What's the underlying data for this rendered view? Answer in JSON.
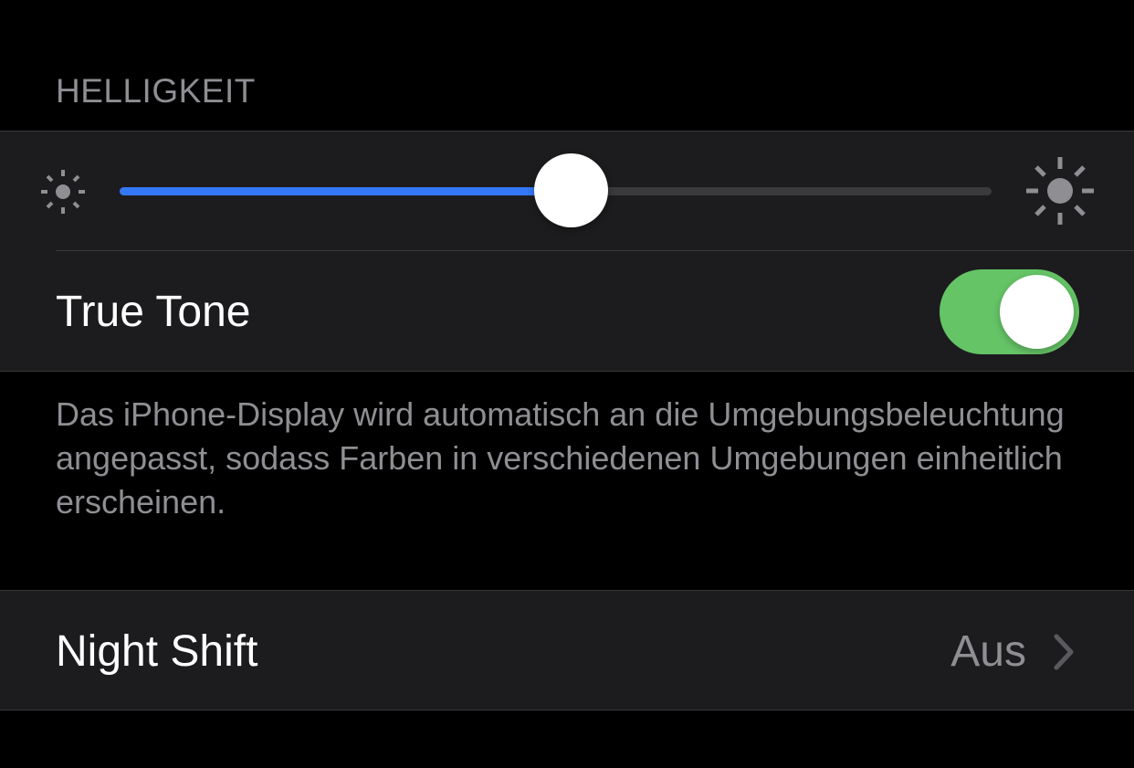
{
  "brightness": {
    "section_header": "HELLIGKEIT",
    "level": 0.52,
    "min_icon": "sun-min-icon",
    "max_icon": "sun-max-icon"
  },
  "true_tone": {
    "label": "True Tone",
    "enabled": true,
    "footnote": "Das iPhone-Display wird automatisch an die Umgebungsbeleuchtung angepasst, sodass Farben in verschiedenen Umgebungen einheitlich erscheinen."
  },
  "night_shift": {
    "label": "Night Shift",
    "value": "Aus",
    "chevron_icon": "chevron-right-icon"
  },
  "colors": {
    "background": "#000000",
    "cell_background": "#1c1c1e",
    "secondary_text": "#8e8e93",
    "slider_fill": "#3478f6",
    "slider_track": "#3a3a3c",
    "toggle_on": "#65c466",
    "separator": "#38383a"
  }
}
